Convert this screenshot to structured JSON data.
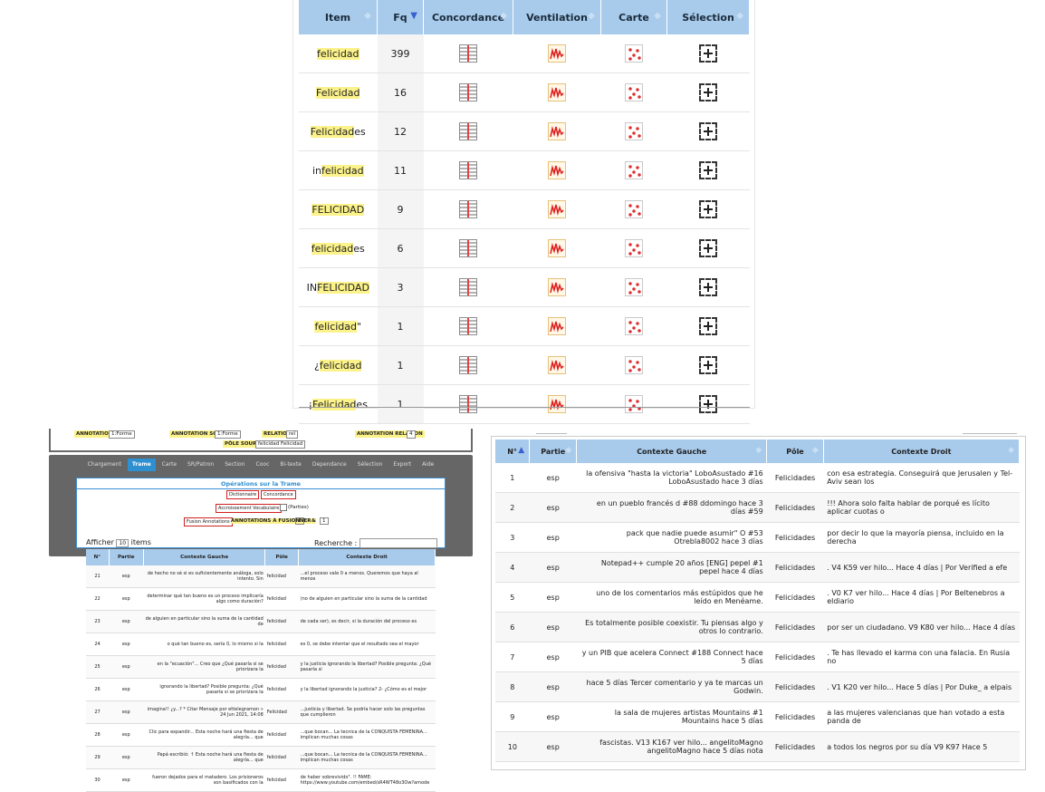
{
  "freq_table": {
    "headers": [
      "Item",
      "Fq",
      "Concordance",
      "Ventilation",
      "Carte",
      "Sélection"
    ],
    "rows": [
      {
        "pre": "",
        "hl": "felicidad",
        "post": "",
        "fq": "399"
      },
      {
        "pre": "",
        "hl": "Felicidad",
        "post": "",
        "fq": "16"
      },
      {
        "pre": "",
        "hl": "Felicidad",
        "post": "es",
        "fq": "12"
      },
      {
        "pre": "in",
        "hl": "felicidad",
        "post": "",
        "fq": "11"
      },
      {
        "pre": "",
        "hl": "FELICIDAD",
        "post": "",
        "fq": "9"
      },
      {
        "pre": "",
        "hl": "felicidad",
        "post": "es",
        "fq": "6"
      },
      {
        "pre": "IN",
        "hl": "FELICIDAD",
        "post": "",
        "fq": "3"
      },
      {
        "pre": "",
        "hl": "felicidad",
        "post": "\"",
        "fq": "1"
      },
      {
        "pre": "¿",
        "hl": "felicidad",
        "post": "",
        "fq": "1"
      },
      {
        "pre": "¡",
        "hl": "Felicidad",
        "post": "es",
        "fq": "1"
      }
    ],
    "icons": [
      "concordance-icon",
      "ventilation-icon",
      "map-icon",
      "selection-icon"
    ]
  },
  "annotation_bar": {
    "annotation_label": "ANNOTATION*",
    "annotation_value": "1:Forme",
    "sortie_label": "ANNOTATION SORTIE",
    "sortie_value": "1:Forme",
    "relation_label": "RELATION",
    "relation_value": "rel",
    "relation_anno_label": "ANNOTATION RELATION",
    "relation_anno_value": "4",
    "pole_label": "PÔLE SOURCE",
    "pole_value": "felicidad Felicidad"
  },
  "tabs": [
    "Chargement",
    "Trame",
    "Carte",
    "SR/Patron",
    "Section",
    "Cooc",
    "Bi-texte",
    "Dependance",
    "Sélection",
    "Export",
    "Aide"
  ],
  "active_tab": "Trame",
  "operations": {
    "title": "Opérations sur la Trame",
    "dictionnaire": "Dictionnaire",
    "concordance": "Concordance",
    "accroissement": "Accroissement Vocabulaire",
    "parties": "(Parties)",
    "fusion": "Fusion Annotations",
    "annot_fusionner": "ANNOTATIONS À FUSIONNER :",
    "a_value": "1",
    "amp": "&",
    "b_value": "1"
  },
  "afficher": {
    "prefix": "Afficher",
    "value": "10",
    "suffix": "items"
  },
  "recherche": {
    "label": "Recherche :"
  },
  "small_table": {
    "headers": [
      "N°",
      "Partie",
      "Contexte Gauche",
      "Pôle",
      "Contexte Droit"
    ],
    "rows": [
      {
        "n": "21",
        "p": "esp",
        "g": "de hecho no sé si es suficientemente análoga, solo intento. Sin",
        "pole": "felicidad",
        "d": "...el proceso vale 0 a menos. Queremos que haya al menos"
      },
      {
        "n": "22",
        "p": "esp",
        "g": "determinar qué tan bueno es un proceso implicaría algo como duración?",
        "pole": "felicidad",
        "d": "(no de alguien en particular sino la suma de la cantidad"
      },
      {
        "n": "23",
        "p": "esp",
        "g": "de alguien en particular sino la suma de la cantidad de",
        "pole": "felicidad",
        "d": "de cada ser), es decir, si la duración del proceso es"
      },
      {
        "n": "24",
        "p": "esp",
        "g": "o qué tan bueno es, sería 0, lo mismo si la",
        "pole": "felicidad",
        "d": "es 0, se debe intentar que el resultado sea el mayor"
      },
      {
        "n": "25",
        "p": "esp",
        "g": "en la \"ecuación\"... Creo que ¿Qué pasaría si se priorizara la",
        "pole": "felicidad",
        "d": "y la justicia ignorando la libertad? Posible pregunta: ¿Qué pasaría si"
      },
      {
        "n": "26",
        "p": "esp",
        "g": "ignorando la libertad? Posible pregunta: ¿Qué pasaría si se priorizara la",
        "pole": "felicidad",
        "d": "y la libertad ignorando la justicia? 2- ¿Cómo es el mejor"
      },
      {
        "n": "27",
        "p": "esp",
        "g": "imagina!! ¿y...? * Citar Mensaje por ettelegramon » 24 Jun 2021, 14:08",
        "pole": "Felicidad",
        "d": "...justicia y libertad. Se podría hacer solo las preguntas que cumplieron"
      },
      {
        "n": "28",
        "p": "esp",
        "g": "Clic para expandir... Esta noche hará una fiesta de alegría... que",
        "pole": "felicidad",
        "d": "...que bocan... La tecnica de la CONQUISTA FEMENINA... implican muchas cosas"
      },
      {
        "n": "29",
        "p": "esp",
        "g": "Papá escribió: ↑ Esta noche hará una fiesta de alegría... que",
        "pole": "felicidad",
        "d": "...que bocan... La tecnica de la CONQUISTA FEMENINA... implican muchas cosas"
      },
      {
        "n": "30",
        "p": "esp",
        "g": "fueron dejados para el matadero. Los prisioneros son basificados con la",
        "pole": "felicidad",
        "d": "de haber sobrevivido\". !! FAME: https://www.youtube.com/embed/sR4WT48o3Ow?amode"
      }
    ]
  },
  "big_table": {
    "headers": [
      "N°",
      "Partie",
      "Contexte Gauche",
      "Pôle",
      "Contexte Droit"
    ],
    "rows": [
      {
        "n": "1",
        "p": "esp",
        "g": "la ofensiva \"hasta la victoria\" LoboAsustado #16 LoboAsustado hace 3 días",
        "pole": "Felicidades",
        "d": "con esa estrategia. Conseguirá que Jerusalen y Tel-Aviv sean los"
      },
      {
        "n": "2",
        "p": "esp",
        "g": "en un pueblo francés d #88 ddomingo hace 3 días #59",
        "pole": "Felicidades",
        "d": "!!! Ahora solo falta hablar de porqué es lícito aplicar cuotas o"
      },
      {
        "n": "3",
        "p": "esp",
        "g": "pack que nadie puede asumir\" O #53 Otrebla8002 hace 3 días",
        "pole": "Felicidades",
        "d": "por decir lo que la mayoría piensa, incluido en la derecha"
      },
      {
        "n": "4",
        "p": "esp",
        "g": "Notepad++ cumple 20 años [ENG] pepel #1 pepel hace 4 días",
        "pole": "Felicidades",
        "d": ". V4 K59 ver hilo... Hace 4 días | Por Verified a efe"
      },
      {
        "n": "5",
        "p": "esp",
        "g": "uno de los comentarios más estúpidos que he leído en Menéame.",
        "pole": "Felicidades",
        "d": ". V0 K7 ver hilo... Hace 4 días | Por Beltenebros a eldiario"
      },
      {
        "n": "6",
        "p": "esp",
        "g": "Es totalmente posible coexistir. Tu piensas algo y otros lo contrario.",
        "pole": "Felicidades",
        "d": "por ser un ciudadano. V9 K80 ver hilo... Hace 4 días"
      },
      {
        "n": "7",
        "p": "esp",
        "g": "y un PIB que acelera Connect #188 Connect hace 5 días",
        "pole": "Felicidades",
        "d": ". Te has llevado el karma con una falacia. En Rusia no"
      },
      {
        "n": "8",
        "p": "esp",
        "g": "hace 5 días Tercer comentario y ya te marcas un Godwin.",
        "pole": "Felicidades",
        "d": ". V1 K20 ver hilo... Hace 5 días | Por Duke_ a elpais"
      },
      {
        "n": "9",
        "p": "esp",
        "g": "la sala de mujeres artistas Mountains #1 Mountains hace 5 días",
        "pole": "Felicidades",
        "d": "a las mujeres valencianas que han votado a esta panda de"
      },
      {
        "n": "10",
        "p": "esp",
        "g": "fascistas. V13 K167 ver hilo... angelitoMagno angelitoMagno hace 5 días nota",
        "pole": "Felicidades",
        "d": "a todos los negros por su día V9 K97 Hace 5"
      }
    ]
  }
}
